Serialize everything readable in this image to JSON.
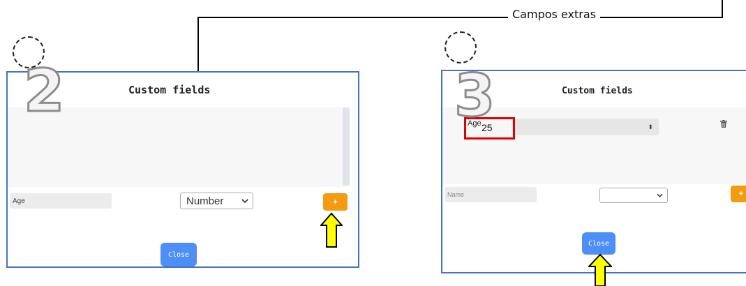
{
  "annotation": {
    "callout_label": "Campos extras"
  },
  "step2": {
    "step_number": "2",
    "dialog_title": "Custom fields",
    "name_input_value": "Age",
    "type_select_value": "Number",
    "add_button_label": "+",
    "close_button_label": "Close"
  },
  "step3": {
    "step_number": "3",
    "dialog_title": "Custom fields",
    "field_label": "Age",
    "field_value": "25",
    "spinner_glyph": "⬍",
    "name_input_placeholder": "Name",
    "type_select_value": "",
    "add_button_label": "+",
    "close_button_label": "Close"
  },
  "colors": {
    "dialog_border": "#4472c4",
    "add_button": "#f39c12",
    "close_button": "#4d8ef7",
    "highlight": "#e00000",
    "arrow_fill": "#ffff00"
  }
}
